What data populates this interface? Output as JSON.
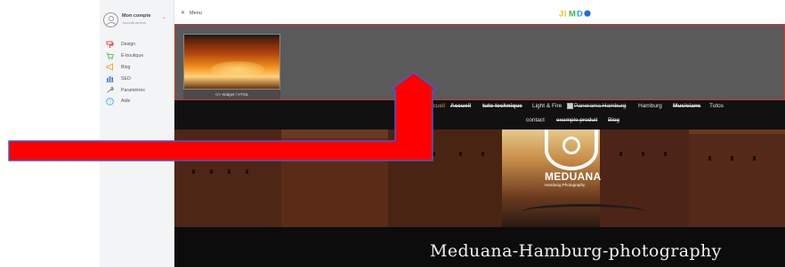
{
  "sidebar": {
    "account": {
      "name": "Mon compte",
      "sub": "JimdoBusiness"
    },
    "items": [
      {
        "label": "Design",
        "icon": "paint-roller-icon",
        "color": "#e84a4a"
      },
      {
        "label": "E-boutique",
        "icon": "cart-icon",
        "color": "#5cbf4a"
      },
      {
        "label": "Blog",
        "icon": "megaphone-icon",
        "color": "#f0a030"
      },
      {
        "label": "SEO",
        "icon": "bar-chart-icon",
        "color": "#2a7fd6"
      },
      {
        "label": "Paramètres",
        "icon": "wrench-icon",
        "color": "#8a8a8a"
      },
      {
        "label": "Aide",
        "icon": "help-icon",
        "color": "#3ab0e0"
      }
    ]
  },
  "topbar": {
    "close_symbol": "✕",
    "menu_label": "Menu",
    "logo": "JIMDO"
  },
  "widget": {
    "caption": "</> Widget / HTML"
  },
  "site_nav": {
    "row1": [
      {
        "label": "Accueil",
        "style": "active"
      },
      {
        "label": "Accueil",
        "style": "strike bold"
      },
      {
        "label": "tuto technique",
        "style": "strike bold"
      },
      {
        "label": "Light & Fire",
        "style": ""
      },
      {
        "label": "Panorama Hamburg",
        "style": "strike"
      },
      {
        "label": "Hamburg",
        "style": ""
      },
      {
        "label": "Musicians",
        "style": "strike bold"
      },
      {
        "label": "Tutos",
        "style": ""
      }
    ],
    "row2": [
      {
        "label": "contact",
        "style": ""
      },
      {
        "label": "exemple produit",
        "style": "strike"
      },
      {
        "label": "Blog",
        "style": "strike"
      }
    ]
  },
  "hero": {
    "logo_title": "MEDUANA",
    "logo_sub": "Hamburg Photography"
  },
  "site_title": "Meduana-Hamburg-photography",
  "colors": {
    "accent_red": "#d0342c",
    "arrow_fill": "#ff0000",
    "arrow_stroke": "#3a5fcd"
  }
}
